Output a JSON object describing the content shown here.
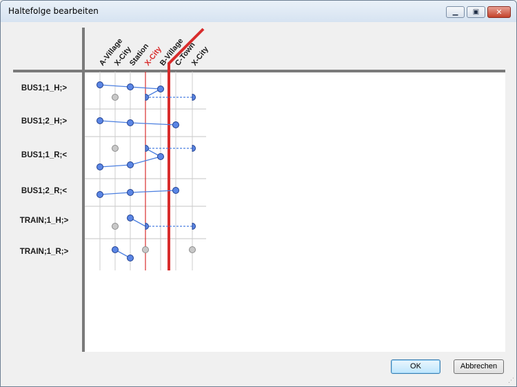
{
  "window": {
    "title": "Haltefolge bearbeiten"
  },
  "title_controls": {
    "minimize": "minimize-icon",
    "maximize": "maximize-icon",
    "close": "close-icon"
  },
  "stations": [
    "A-Village",
    "X-City",
    "Station",
    "X-City",
    "B-Village",
    "C-Town",
    "X-City"
  ],
  "highlight_station": "X-City",
  "colors": {
    "highlight": "#d82c2c",
    "stop": "#5b86e5",
    "inactive": "#c8c8c8",
    "line": "#4b7fe0"
  },
  "rows": [
    {
      "label": "BUS1;1_H;>"
    },
    {
      "label": "BUS1;2_H;>"
    },
    {
      "label": "BUS1;1_R;<"
    },
    {
      "label": "BUS1;2_R;<"
    },
    {
      "label": "TRAIN;1_H;>"
    },
    {
      "label": "TRAIN;1_R;>"
    }
  ],
  "buttons": {
    "ok": "OK",
    "cancel": "Abbrechen"
  }
}
